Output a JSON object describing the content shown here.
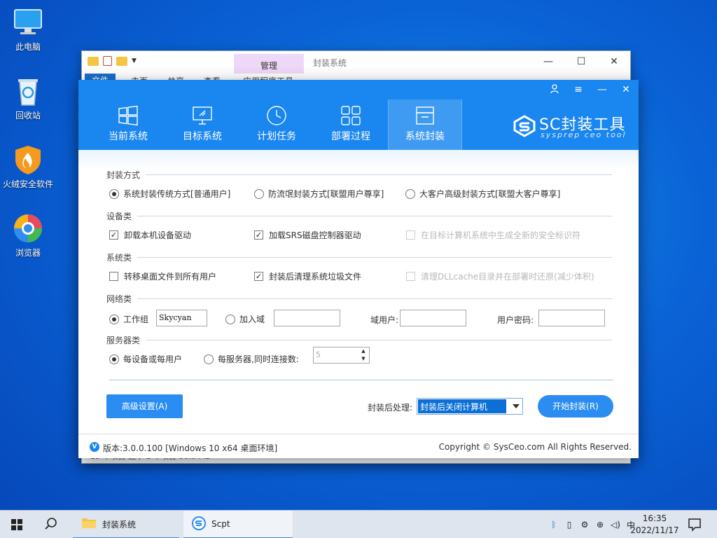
{
  "desktop": {
    "icons": [
      {
        "label": "此电脑"
      },
      {
        "label": "回收站"
      },
      {
        "label": "火绒安全软件"
      },
      {
        "label": "浏览器"
      }
    ]
  },
  "explorer": {
    "manage_label": "管理",
    "title": "封装系统",
    "tabs": [
      "文件",
      "主页",
      "共享",
      "查看",
      "应用程序工具"
    ],
    "status": "19 个项目   选中 1 个项目 90.0 MB"
  },
  "sc": {
    "nav": [
      {
        "label": "当前系统",
        "icon": "windows-icon"
      },
      {
        "label": "目标系统",
        "icon": "monitor-icon"
      },
      {
        "label": "计划任务",
        "icon": "clock-icon"
      },
      {
        "label": "部署过程",
        "icon": "grid-icon"
      },
      {
        "label": "系统封装",
        "icon": "archive-icon",
        "active": true
      }
    ],
    "logo_name": "SC封装工具",
    "logo_sub": "sysprep ceo tool",
    "sections": {
      "mode": {
        "title": "封装方式",
        "options": [
          {
            "label": "系统封装传统方式[普通用户]",
            "checked": true
          },
          {
            "label": "防流氓封装方式[联盟用户尊享]",
            "checked": false
          },
          {
            "label": "大客户高级封装方式[联盟大客户尊享]",
            "checked": false
          }
        ]
      },
      "device": {
        "title": "设备类",
        "options": [
          {
            "label": "卸载本机设备驱动",
            "checked": true
          },
          {
            "label": "加载SRS磁盘控制器驱动",
            "checked": true
          },
          {
            "label": "在目标计算机系统中生成全新的安全标识符",
            "checked": false,
            "disabled": true
          }
        ]
      },
      "system": {
        "title": "系统类",
        "options": [
          {
            "label": "转移桌面文件到所有用户",
            "checked": false
          },
          {
            "label": "封装后清理系统垃圾文件",
            "checked": true
          },
          {
            "label": "清理DLLcache目录并在部署时还原(减少体积)",
            "checked": false,
            "disabled": true
          }
        ]
      },
      "network": {
        "title": "网络类",
        "workgroup_label": "工作组",
        "workgroup_value": "Skycyan",
        "domain_label": "加入域",
        "domain_user_label": "域用户:",
        "domain_pass_label": "用户密码:"
      },
      "server": {
        "title": "服务器类",
        "per_device_label": "每设备或每用户",
        "per_server_label": "每服务器,同时连接数:",
        "connections": "5"
      }
    },
    "advanced_button": "高级设置(A)",
    "after_label": "封装后处理:",
    "after_value": "封装后关闭计算机",
    "start_button": "开始封装(R)",
    "version_icon": "V",
    "version": "版本:3.0.0.100 [Windows 10 x64 桌面环境]",
    "copyright": "Copyright © SysCeo.com All Rights Reserved."
  },
  "taskbar": {
    "apps": [
      {
        "label": "封装系统"
      },
      {
        "label": "Scpt"
      }
    ],
    "ime": "中",
    "time": "16:35",
    "date": "2022/11/17"
  }
}
